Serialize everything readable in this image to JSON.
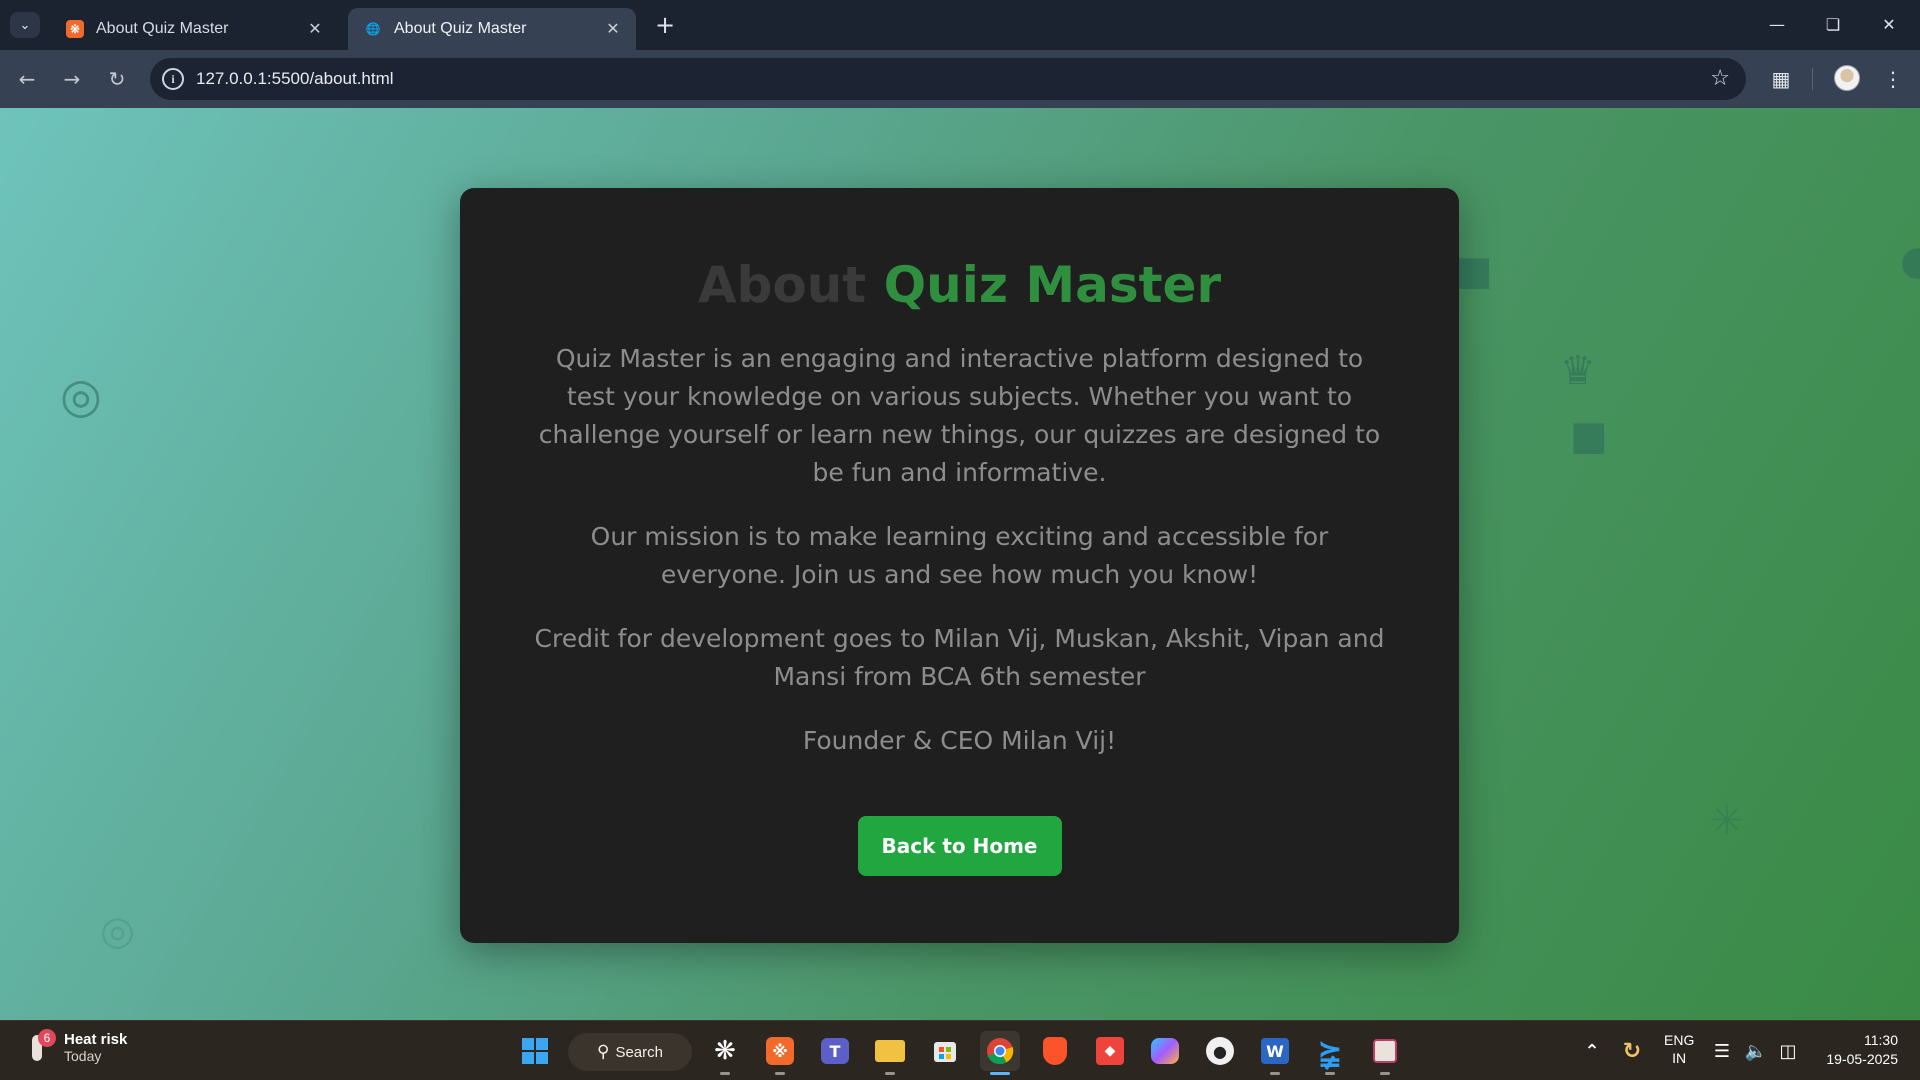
{
  "browser": {
    "tabs": [
      {
        "title": "About Quiz Master",
        "favicon": "xampp-icon",
        "active": false
      },
      {
        "title": "About Quiz Master",
        "favicon": "globe-icon",
        "active": true
      }
    ],
    "url": "127.0.0.1:5500/about.html"
  },
  "page": {
    "heading_prefix": "About",
    "heading_highlight": "Quiz Master",
    "paragraphs": [
      "Quiz Master is an engaging and interactive platform designed to test your knowledge on various subjects. Whether you want to challenge yourself or learn new things, our quizzes are designed to be fun and informative.",
      "Our mission is to make learning exciting and accessible for everyone. Join us and see how much you know!",
      "Credit for development goes to Milan Vij, Muskan, Akshit, Vipan and Mansi from BCA 6th semester",
      "Founder & CEO Milan Vij!"
    ],
    "button_label": "Back to Home",
    "colors": {
      "accent": "#2f8f3f",
      "button": "#22a63f",
      "card": "#1f1f1f"
    }
  },
  "taskbar": {
    "weather_badge": "6",
    "weather_title": "Heat risk",
    "weather_sub": "Today",
    "search_label": "Search",
    "lang_line1": "ENG",
    "lang_line2": "IN",
    "time": "11:30",
    "date": "19-05-2025",
    "apps": [
      "start",
      "search",
      "chatgpt",
      "xampp",
      "teams",
      "file-explorer",
      "microsoft-store",
      "chrome",
      "brave",
      "anydesk",
      "copilot",
      "github",
      "word",
      "vscode",
      "snipping-tool"
    ]
  }
}
